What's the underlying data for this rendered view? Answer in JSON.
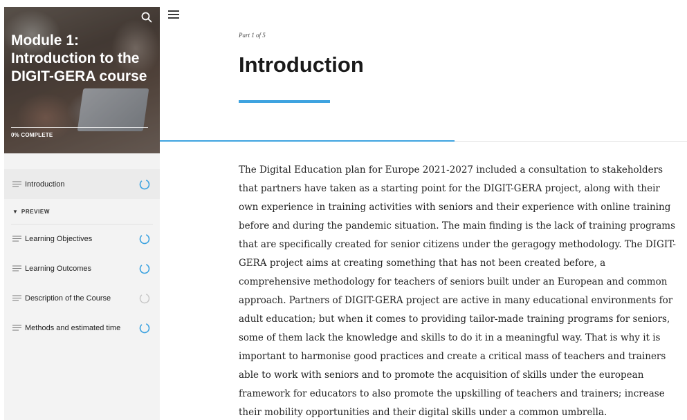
{
  "sidebar": {
    "module_title": "Module 1: Introduction to the DIGIT-GERA course",
    "progress_text": "0% COMPLETE",
    "progress_value": 0,
    "section_label": "PREVIEW",
    "items": [
      {
        "label": "Introduction",
        "icon": "lines-icon",
        "status": "in-progress"
      },
      {
        "label": "Learning Objectives",
        "icon": "lines-icon",
        "status": "in-progress"
      },
      {
        "label": "Learning Outcomes",
        "icon": "lines-icon",
        "status": "in-progress"
      },
      {
        "label": "Description of the Course",
        "icon": "lines-icon",
        "status": "not-started"
      },
      {
        "label": "Methods and estimated time",
        "icon": "lines-icon",
        "status": "in-progress"
      }
    ]
  },
  "header": {
    "part": "Part 1 of 5",
    "title": "Introduction"
  },
  "content": {
    "paragraph": "The Digital Education plan for Europe 2021-2027 included a consultation to stakeholders that partners have taken as a starting point for the DIGIT-GERA project, along with their own experience in training activities with seniors and their experience with online training before and during the pandemic situation. The main finding is the lack of training programs that are specifically created for senior citizens under the geragogy methodology. The DIGIT-GERA project aims at creating something that has not been created before, a comprehensive methodology for teachers of seniors built under an European and common approach. Partners of DIGIT-GERA project are active in many educational environments for adult education; but when it comes to providing tailor-made training programs for seniors, some of them lack the knowledge and skills to do it in a meaningful way. That is why it is important to harmonise good practices and create a critical mass of teachers and trainers able to work with seniors and to promote the acquisition of skills under the european framework for educators to also promote the upskilling of teachers and trainers; increase their mobility opportunities and their digital skills under a common umbrella."
  },
  "colors": {
    "accent": "#3ea3e0",
    "sidebar_bg": "#f3f3f3",
    "active_item_bg": "#ebebeb"
  }
}
